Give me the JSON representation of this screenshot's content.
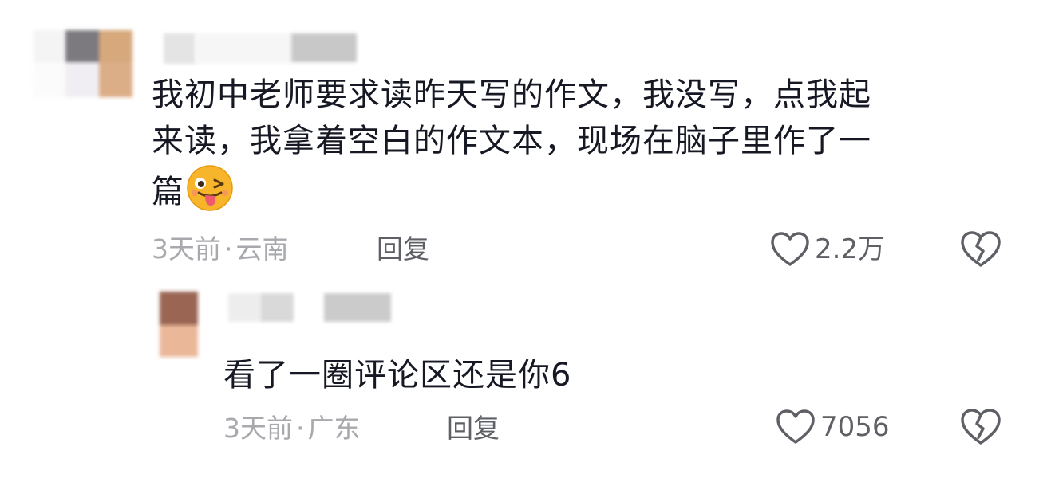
{
  "comment": {
    "text_lines": [
      "我初中老师要求读昨天写的作文，我没写，点我起",
      "来读，我拿着空白的作文本，现场在脑子里作了一",
      "篇"
    ],
    "emoji": "tongue-wink-emoji",
    "time": "3天前",
    "separator": "·",
    "location": "云南",
    "reply_label": "回复",
    "likes": "2.2万"
  },
  "reply": {
    "text": "看了一圈评论区还是你6",
    "time": "3天前",
    "separator": "·",
    "location": "广东",
    "reply_label": "回复",
    "likes": "7056"
  },
  "colors": {
    "text": "#161823",
    "meta": "#a8a9ad",
    "action": "#5f6066",
    "emoji_face": "#f7b52b"
  },
  "icons": [
    "heart-outline-icon",
    "broken-heart-icon"
  ]
}
